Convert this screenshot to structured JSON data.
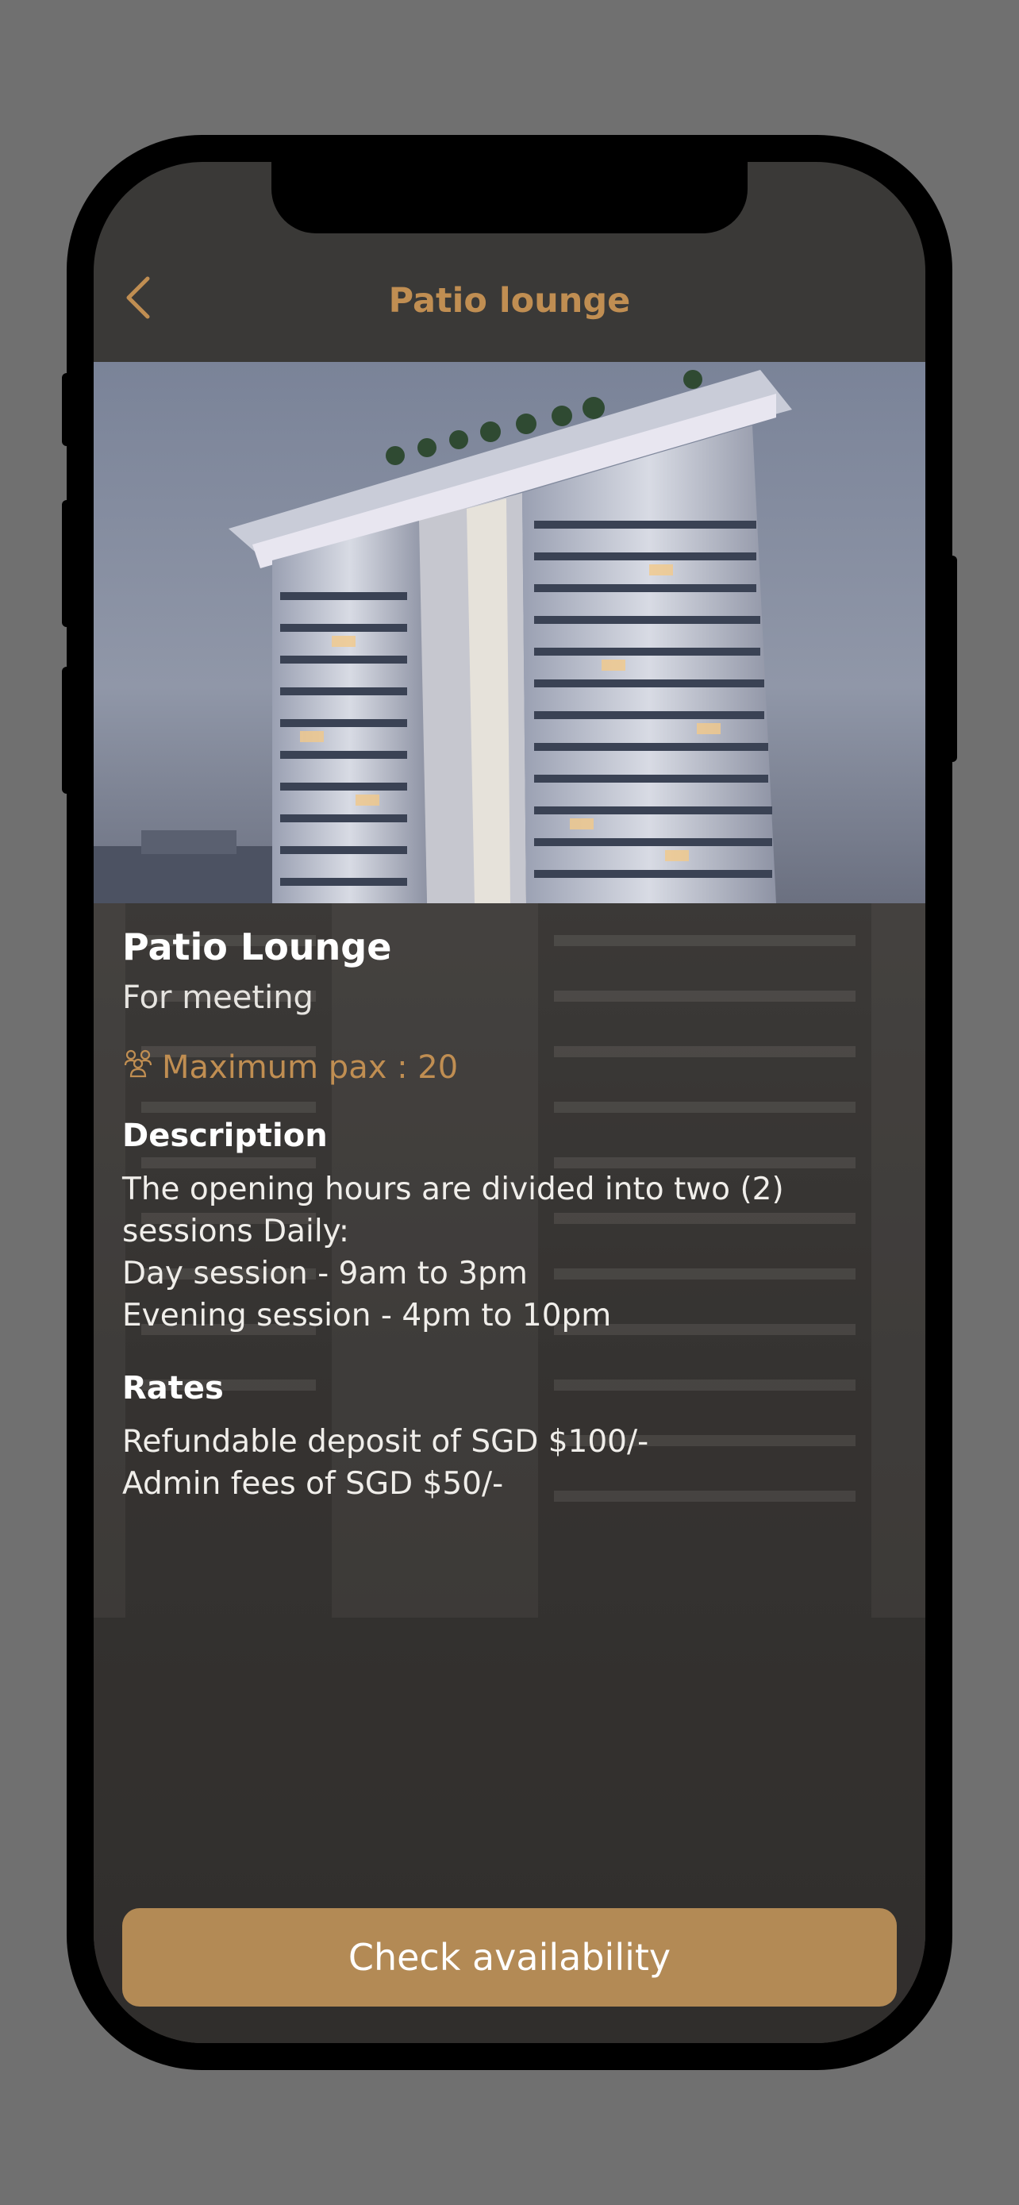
{
  "nav": {
    "title": "Patio lounge",
    "back_icon": "chevron-left-icon"
  },
  "venue": {
    "name": "Patio Lounge",
    "purpose": "For meeting",
    "pax_icon": "people-group-icon",
    "max_pax": "Maximum pax : 20"
  },
  "description": {
    "heading": "Description",
    "lines": [
      "The opening hours are divided into two (2)",
      "sessions Daily:",
      "Day session - 9am to 3pm",
      "Evening session - 4pm to 10pm"
    ]
  },
  "rates": {
    "heading": "Rates",
    "lines": [
      "Refundable deposit of SGD $100/-",
      "Admin fees of SGD $50/-"
    ]
  },
  "cta": {
    "label": "Check availability"
  },
  "colors": {
    "accent": "#c08e52",
    "button": "#b38a55",
    "background": "#3a3937",
    "frame": "#707070"
  }
}
